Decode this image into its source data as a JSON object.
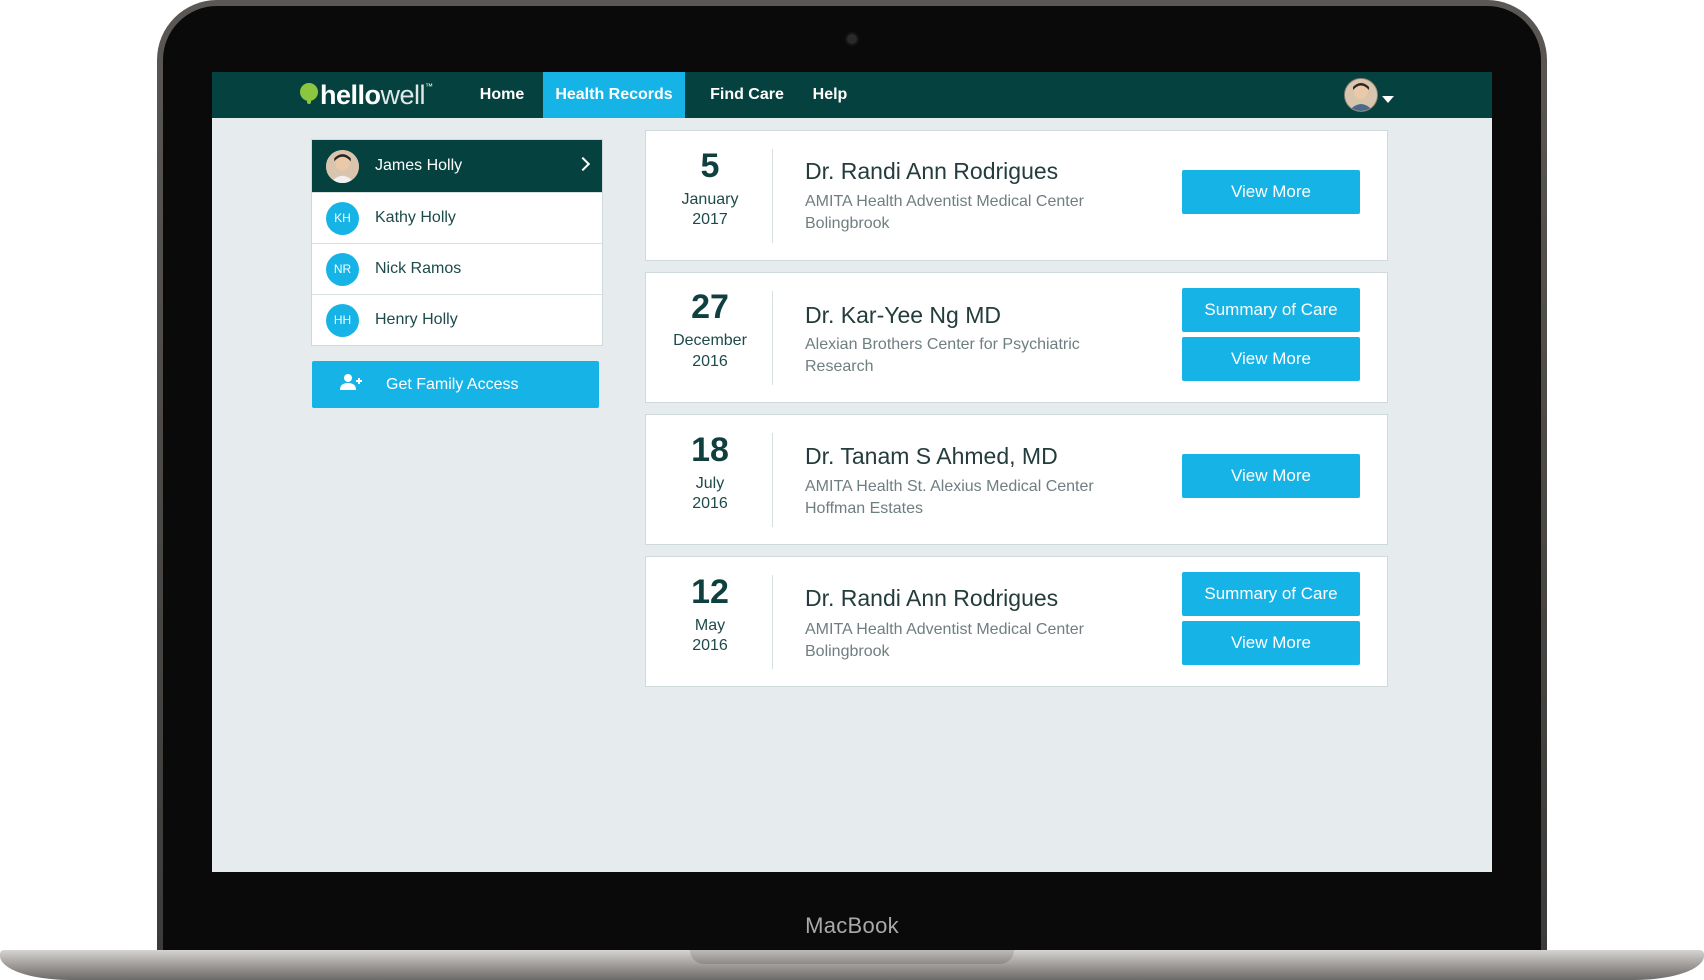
{
  "device": {
    "label": "MacBook"
  },
  "app": {
    "logo_bold": "hello",
    "logo_light": "well",
    "logo_tm": "™"
  },
  "nav": {
    "items": [
      {
        "label": "Home",
        "active": false
      },
      {
        "label": "Health Records",
        "active": true
      },
      {
        "label": "Find Care",
        "active": false
      },
      {
        "label": "Help",
        "active": false
      }
    ]
  },
  "family": {
    "members": [
      {
        "name": "James Holly",
        "initials": "",
        "active": true
      },
      {
        "name": "Kathy Holly",
        "initials": "KH",
        "active": false
      },
      {
        "name": "Nick Ramos",
        "initials": "NR",
        "active": false
      },
      {
        "name": "Henry Holly",
        "initials": "HH",
        "active": false
      }
    ],
    "access_button": "Get Family Access"
  },
  "visits": [
    {
      "day": "5",
      "month": "January",
      "year": "2017",
      "doctor": "Dr. Randi Ann Rodrigues",
      "facility_line1": "AMITA Health Adventist Medical Center",
      "facility_line2": "Bolingbrook",
      "summary_button": "",
      "view_button": "View More"
    },
    {
      "day": "27",
      "month": "December",
      "year": "2016",
      "doctor": "Dr. Kar-Yee Ng MD",
      "facility_line1": "Alexian Brothers Center for Psychiatric",
      "facility_line2": "Research",
      "summary_button": "Summary of Care",
      "view_button": "View More"
    },
    {
      "day": "18",
      "month": "July",
      "year": "2016",
      "doctor": "Dr. Tanam S Ahmed, MD",
      "facility_line1": "AMITA Health St. Alexius Medical Center",
      "facility_line2": "Hoffman Estates",
      "summary_button": "",
      "view_button": "View More"
    },
    {
      "day": "12",
      "month": "May",
      "year": "2016",
      "doctor": "Dr. Randi Ann Rodrigues",
      "facility_line1": "AMITA Health Adventist Medical Center",
      "facility_line2": "Bolingbrook",
      "summary_button": "Summary of Care",
      "view_button": "View More"
    }
  ],
  "colors": {
    "nav_bg": "#05423f",
    "accent": "#16b3e6",
    "page_bg": "#e6ecee",
    "logo_green": "#8cc63f"
  },
  "icons": {
    "logo": "speech-bubble-icon",
    "user_menu": "caret-down-icon",
    "member_open": "chevron-right-icon",
    "family_access": "add-user-icon"
  }
}
